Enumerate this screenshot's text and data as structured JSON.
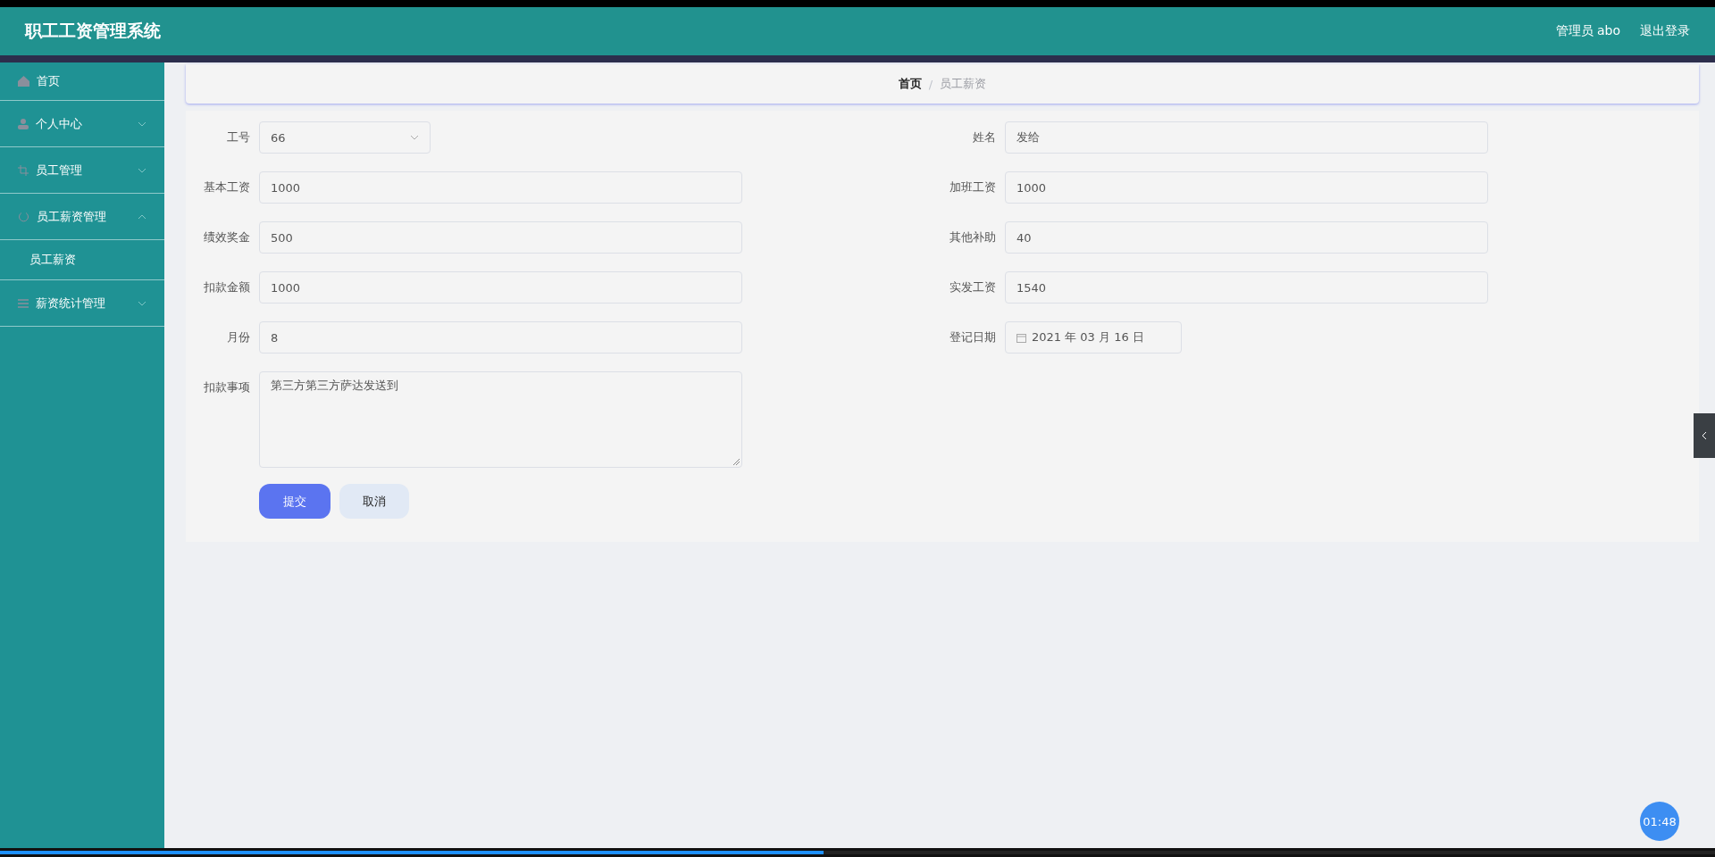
{
  "header": {
    "title": "职工工资管理系统",
    "user": "管理员 abo",
    "logout": "退出登录"
  },
  "sidebar": {
    "items": [
      {
        "label": "首页"
      },
      {
        "label": "个人中心",
        "expanded": false
      },
      {
        "label": "员工管理",
        "expanded": false
      },
      {
        "label": "员工薪资管理",
        "expanded": true,
        "children": [
          {
            "label": "员工薪资"
          }
        ]
      },
      {
        "label": "薪资统计管理",
        "expanded": false
      }
    ]
  },
  "breadcrumb": [
    {
      "label": "首页"
    },
    {
      "label": "员工薪资"
    }
  ],
  "breadcrumb_separator": "/",
  "form": {
    "rows": [
      [
        {
          "label": "工号",
          "kind": "select",
          "value": "66"
        },
        {
          "label": "姓名",
          "kind": "text",
          "value": "发给"
        }
      ],
      [
        {
          "label": "基本工资",
          "kind": "text",
          "value": "1000"
        },
        {
          "label": "加班工资",
          "kind": "text",
          "value": "1000"
        }
      ],
      [
        {
          "label": "绩效奖金",
          "kind": "text",
          "value": "500"
        },
        {
          "label": "其他补助",
          "kind": "text",
          "value": "40"
        }
      ],
      [
        {
          "label": "扣款金额",
          "kind": "text",
          "value": "1000"
        },
        {
          "label": "实发工资",
          "kind": "text",
          "value": "1540"
        }
      ],
      [
        {
          "label": "月份",
          "kind": "text",
          "value": "8"
        },
        {
          "label": "登记日期",
          "kind": "date",
          "value": "2021 年 03 月 16 日"
        }
      ],
      [
        {
          "label": "扣款事项",
          "kind": "textarea",
          "value": "第三方第三方萨达发送到"
        }
      ]
    ],
    "buttons": [
      {
        "label": "提交",
        "kind": "primary"
      },
      {
        "label": "取消",
        "kind": "secondary"
      }
    ]
  },
  "timer": "01:48",
  "player": {
    "level": 0.48
  }
}
